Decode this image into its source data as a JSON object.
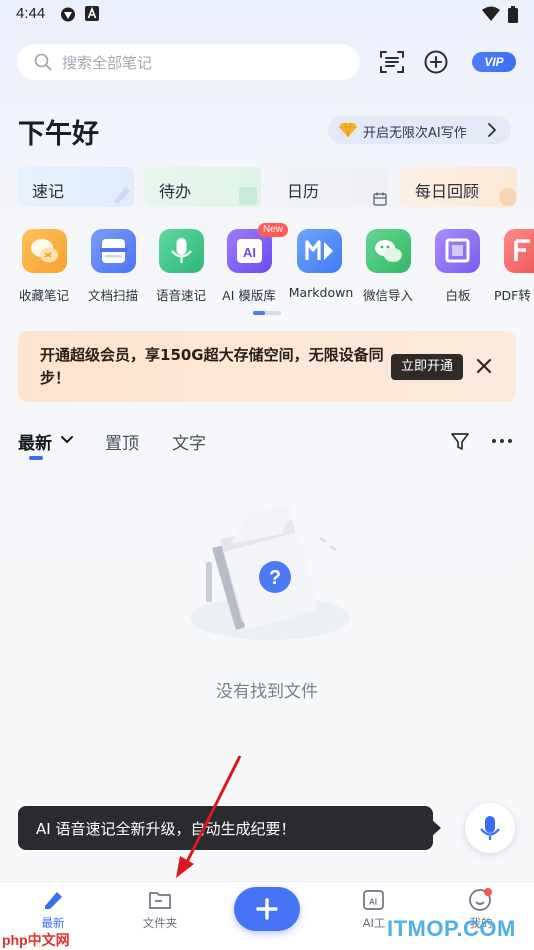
{
  "status_bar": {
    "time": "4:44"
  },
  "search": {
    "placeholder": "搜索全部笔记"
  },
  "header": {
    "vip_label": "VIP",
    "greeting": "下午好",
    "ai_pill": "开启无限次AI写作"
  },
  "quick_actions": [
    {
      "label": "速记",
      "color": "#e3effd"
    },
    {
      "label": "待办",
      "color": "#e4f6ec"
    },
    {
      "label": "日历",
      "color": "#eef1f8"
    },
    {
      "label": "每日回顾",
      "color": "#fdf0e3"
    }
  ],
  "tools": [
    {
      "label": "收藏笔记",
      "icon": "bookmark-chat-icon",
      "color": "#f7a53b"
    },
    {
      "label": "文档扫描",
      "icon": "document-scan-icon",
      "color": "#5b82f6"
    },
    {
      "label": "语音速记",
      "icon": "microphone-icon",
      "color": "#3ec28a"
    },
    {
      "label": "AI 模版库",
      "icon": "ai-template-icon",
      "color": "#7d5cf2",
      "badge": "New"
    },
    {
      "label": "Markdown",
      "icon": "markdown-icon",
      "color": "#4b86f6"
    },
    {
      "label": "微信导入",
      "icon": "wechat-icon",
      "color": "#3ec277"
    },
    {
      "label": "白板",
      "icon": "whiteboard-icon",
      "color": "#8a6df4"
    },
    {
      "label": "PDF转",
      "icon": "pdf-icon",
      "color": "#f26b6b"
    }
  ],
  "vip_banner": {
    "text": "开通超级会员，享150G超大存储空间，无限设备同步！",
    "button": "立即开通"
  },
  "tabs": [
    {
      "label": "最新"
    },
    {
      "label": "置顶"
    },
    {
      "label": "文字"
    }
  ],
  "empty_state": {
    "text": "没有找到文件"
  },
  "toast": {
    "text": "AI 语音速记全新升级，自动生成纪要！"
  },
  "bottom_nav": [
    {
      "label": "最新"
    },
    {
      "label": "文件夹"
    },
    {
      "label": "AI工"
    },
    {
      "label": "我的"
    }
  ],
  "watermarks": {
    "left": "php中文网",
    "right": "ITMOP.COM"
  },
  "colors": {
    "accent": "#3b6ff2",
    "vip_banner_bg": "#fde4cf",
    "toast_bg": "#2a2b31"
  }
}
